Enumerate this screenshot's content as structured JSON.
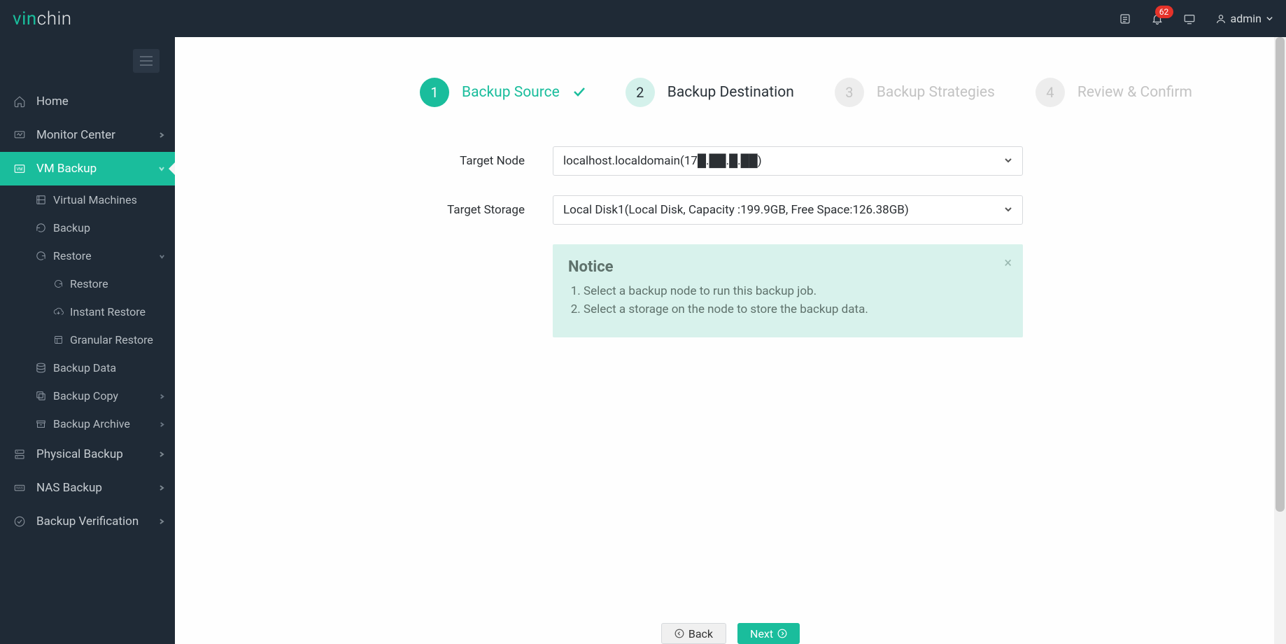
{
  "brand": {
    "prefix": "vin",
    "rest": "chin"
  },
  "topbar": {
    "badge": "62",
    "user": "admin"
  },
  "sidebar": {
    "items": [
      {
        "label": "Home"
      },
      {
        "label": "Monitor Center"
      },
      {
        "label": "VM Backup"
      },
      {
        "label": "Physical Backup"
      },
      {
        "label": "NAS Backup"
      },
      {
        "label": "Backup Verification"
      }
    ],
    "vm_sub": [
      {
        "label": "Virtual Machines"
      },
      {
        "label": "Backup"
      },
      {
        "label": "Restore"
      },
      {
        "label": "Backup Data"
      },
      {
        "label": "Backup Copy"
      },
      {
        "label": "Backup Archive"
      }
    ],
    "restore_sub": [
      {
        "label": "Restore"
      },
      {
        "label": "Instant Restore"
      },
      {
        "label": "Granular Restore"
      }
    ]
  },
  "steps": [
    {
      "num": "1",
      "label": "Backup Source"
    },
    {
      "num": "2",
      "label": "Backup Destination"
    },
    {
      "num": "3",
      "label": "Backup Strategies"
    },
    {
      "num": "4",
      "label": "Review & Confirm"
    }
  ],
  "form": {
    "target_node_label": "Target Node",
    "target_node_value": "localhost.localdomain(17█.██.█.██)",
    "target_storage_label": "Target Storage",
    "target_storage_value": "Local Disk1(Local Disk, Capacity :199.9GB, Free Space:126.38GB)"
  },
  "notice": {
    "title": "Notice",
    "items": [
      "Select a backup node to run this backup job.",
      "Select a storage on the node to store the backup data."
    ]
  },
  "buttons": {
    "back": "Back",
    "next": "Next"
  }
}
